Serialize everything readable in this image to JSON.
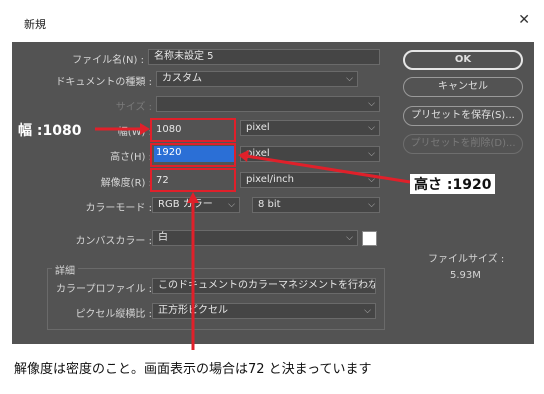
{
  "window": {
    "title": "新規",
    "close_glyph": "✕"
  },
  "form": {
    "filename_label": "ファイル名(N) :",
    "filename_value": "名称未設定 5",
    "doctype_label": "ドキュメントの種類 :",
    "doctype_value": "カスタム",
    "size_label": "サイズ :",
    "width_label": "幅(W) :",
    "width_value": "1080",
    "width_unit": "pixel",
    "height_label": "高さ(H) :",
    "height_value": "1920",
    "height_unit": "pixel",
    "resolution_label": "解像度(R) :",
    "resolution_value": "72",
    "resolution_unit": "pixel/inch",
    "colormode_label": "カラーモード :",
    "colormode_value": "RGB カラー",
    "bitdepth_value": "8 bit",
    "canvas_label": "カンバスカラー :",
    "canvas_value": "白",
    "advanced_label": "詳細",
    "profile_label": "カラープロファイル :",
    "profile_value": "このドキュメントのカラーマネジメントを行わない",
    "pixel_aspect_label": "ピクセル縦横比 :",
    "pixel_aspect_value": "正方形ピクセル"
  },
  "buttons": {
    "ok": "OK",
    "cancel": "キャンセル",
    "save_preset": "プリセットを保存(S)...",
    "delete_preset": "プリセットを削除(D)..."
  },
  "info": {
    "filesize_label": "ファイルサイズ :",
    "filesize_value": "5.93M"
  },
  "annotations": {
    "width": "幅 :1080",
    "height": "高さ :1920",
    "note": "解像度は密度のこと。画面表示の場合は72 と決まっています"
  },
  "colors": {
    "highlight": "#e0202a",
    "dialog_bg": "#535353"
  }
}
